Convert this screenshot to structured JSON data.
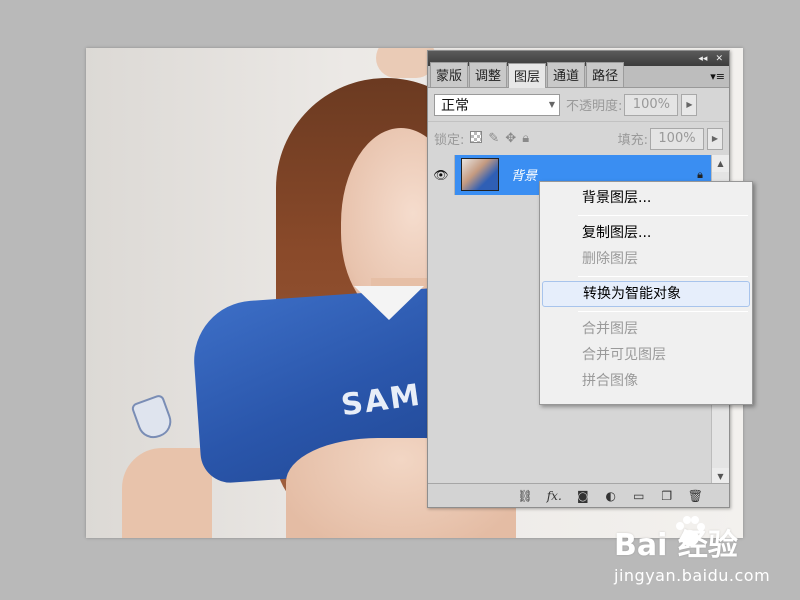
{
  "panel": {
    "title_buttons": [
      "◂◂",
      "✕"
    ],
    "tabs": [
      {
        "label": "蒙版"
      },
      {
        "label": "调整"
      },
      {
        "label": "图层"
      },
      {
        "label": "通道"
      },
      {
        "label": "路径"
      }
    ],
    "active_tab": "图层",
    "tab_menu_icon": "▾≡",
    "blend_mode": "正常",
    "opacity_label": "不透明度:",
    "opacity_value": "100%",
    "lock_label": "锁定:",
    "fill_label": "填充:",
    "fill_value": "100%",
    "layer": {
      "name": "背景",
      "locked_icon": "lock-icon",
      "visible_icon": "eye-icon"
    },
    "footer_icons": [
      "link-icon",
      "fx-icon",
      "mask-icon",
      "adjustment-icon",
      "folder-icon",
      "new-layer-icon",
      "trash-icon"
    ],
    "footer_fx_label": "fx."
  },
  "context_menu": {
    "items": [
      {
        "label": "背景图层...",
        "disabled": false
      },
      {
        "separator": true
      },
      {
        "label": "复制图层...",
        "disabled": false
      },
      {
        "label": "删除图层",
        "disabled": true
      },
      {
        "separator": true
      },
      {
        "label": "转换为智能对象",
        "disabled": false,
        "highlighted": true
      },
      {
        "separator": true
      },
      {
        "label": "合并图层",
        "disabled": true
      },
      {
        "label": "合并可见图层",
        "disabled": true
      },
      {
        "label": "拼合图像",
        "disabled": true
      }
    ]
  },
  "canvas": {
    "shirt_text": "SAM"
  },
  "watermark": {
    "brand": "Bai  经验",
    "url": "jingyan.baidu.com"
  },
  "colors": {
    "selection_blue": "#3a8ef2",
    "panel_bg": "#d6d6d6",
    "workspace_bg": "#b9b9b9"
  }
}
